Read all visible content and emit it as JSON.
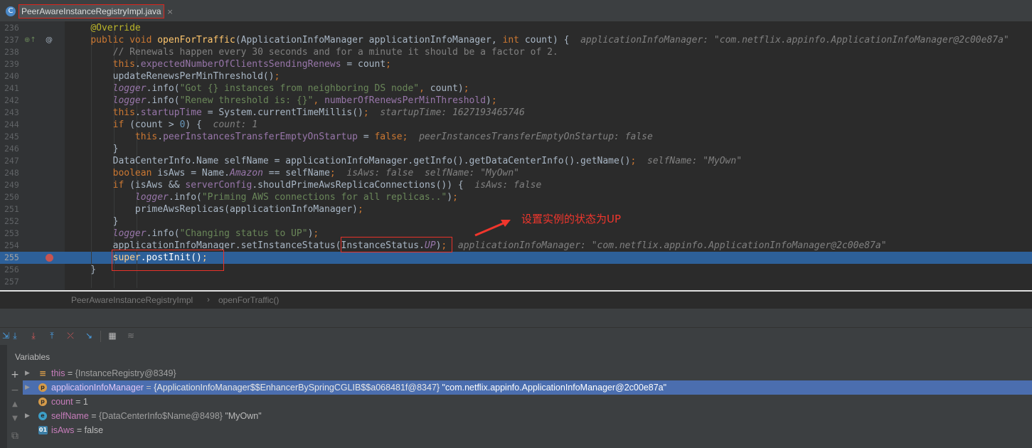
{
  "tab": {
    "title": "PeerAwareInstanceRegistryImpl.java",
    "icon": "C",
    "close": "×"
  },
  "gutter_icons": {
    "override": "⊕↑",
    "annotation": "@"
  },
  "lines": [
    {
      "n": "236",
      "html": "<span class=\"ann\">@Override</span>"
    },
    {
      "n": "237",
      "html": "<span class=\"kw\">public void </span><span class=\"fn\">openForTraffic</span>(ApplicationInfoManager applicationInfoManager, <span class=\"kw\">int </span>count) {  <span class=\"inlay\">applicationInfoManager: \"com.netflix.appinfo.ApplicationInfoManager@2c00e87a\"</span>"
    },
    {
      "n": "238",
      "html": "    <span class=\"cmt\">// Renewals happen every 30 seconds and for a minute it should be a factor of 2.</span>"
    },
    {
      "n": "239",
      "html": "    <span class=\"kw\">this</span>.<span class=\"field\">expectedNumberOfClientsSendingRenews </span>= count<span class=\"kw\">;</span>"
    },
    {
      "n": "240",
      "html": "    updateRenewsPerMinThreshold()<span class=\"kw\">;</span>"
    },
    {
      "n": "241",
      "html": "    <span class=\"logger\">logger</span>.info(<span class=\"str\">\"Got {} instances from neighboring DS node\"</span><span class=\"kw\">, </span>count)<span class=\"kw\">;</span>"
    },
    {
      "n": "242",
      "html": "    <span class=\"logger\">logger</span>.info(<span class=\"str\">\"Renew threshold is: {}\"</span><span class=\"kw\">, </span><span class=\"field\">numberOfRenewsPerMinThreshold</span>)<span class=\"kw\">;</span>"
    },
    {
      "n": "243",
      "html": "    <span class=\"kw\">this</span>.<span class=\"field\">startupTime </span>= System.<span class=\"fn\" style=\"color:#a9b7c6\">currentTimeMillis</span>()<span class=\"kw\">;</span>  <span class=\"inlay\">startupTime: 1627193465746</span>"
    },
    {
      "n": "244",
      "html": "    <span class=\"kw\">if </span>(count &gt; <span class=\"num\">0</span>) {  <span class=\"inlay\">count: 1</span>"
    },
    {
      "n": "245",
      "html": "        <span class=\"kw\">this</span>.<span class=\"field\">peerInstancesTransferEmptyOnStartup </span>= <span class=\"kw\">false;</span>  <span class=\"inlay\">peerInstancesTransferEmptyOnStartup: false</span>"
    },
    {
      "n": "246",
      "html": "    }"
    },
    {
      "n": "247",
      "html": "    DataCenterInfo.Name selfName = applicationInfoManager.getInfo().getDataCenterInfo().getName()<span class=\"kw\">;</span>  <span class=\"inlay\">selfName: \"MyOwn\"</span>"
    },
    {
      "n": "248",
      "html": "    <span class=\"kw\">boolean </span>isAws = Name.<span class=\"static-f\">Amazon </span>== selfName<span class=\"kw\">;</span>  <span class=\"inlay\">isAws: false  selfName: \"MyOwn\"</span>"
    },
    {
      "n": "249",
      "html": "    <span class=\"kw\">if </span>(isAws &amp;&amp; <span class=\"field\">serverConfig</span>.shouldPrimeAwsReplicaConnections()) {  <span class=\"inlay\">isAws: false</span>"
    },
    {
      "n": "250",
      "html": "        <span class=\"logger\">logger</span>.info(<span class=\"str\">\"Priming AWS connections for all replicas..\"</span>)<span class=\"kw\">;</span>"
    },
    {
      "n": "251",
      "html": "        primeAwsReplicas(applicationInfoManager)<span class=\"kw\">;</span>"
    },
    {
      "n": "252",
      "html": "    }"
    },
    {
      "n": "253",
      "html": "    <span class=\"logger\">logger</span>.info(<span class=\"str\">\"Changing status to UP\"</span>)<span class=\"kw\">;</span>"
    },
    {
      "n": "254",
      "html": "    applicationInfoManager.setInstanceStatus(InstanceStatus.<span class=\"static-f\">UP</span>)<span class=\"kw\">;</span>  <span class=\"inlay\">applicationInfoManager: \"com.netflix.appinfo.ApplicationInfoManager@2c00e87a\"</span>"
    },
    {
      "n": "255",
      "html": "    <span class=\"kw\">super</span>.postInit()<span class=\"kw\">;</span>"
    },
    {
      "n": "256",
      "html": "}"
    },
    {
      "n": "257",
      "html": ""
    }
  ],
  "annotation_text": "设置实例的状态为UP",
  "breadcrumb": {
    "class_name": "PeerAwareInstanceRegistryImpl",
    "separator": "›",
    "method": "openForTraffic()"
  },
  "variables": {
    "title": "Variables",
    "rows": [
      {
        "name": "this",
        "eq": " = ",
        "type": "{InstanceRegistry@8349}",
        "value": "",
        "icon": "this-icon",
        "expandable": true,
        "selected": false
      },
      {
        "name": "applicationInfoManager",
        "eq": " = ",
        "type": "{ApplicationInfoManager$$EnhancerBySpringCGLIB$$a068481f@8347}",
        "value": " \"com.netflix.appinfo.ApplicationInfoManager@2c00e87a\"",
        "icon": "p",
        "expandable": true,
        "selected": true
      },
      {
        "name": "count",
        "eq": " = ",
        "type": "",
        "value": "1",
        "icon": "p",
        "expandable": false,
        "selected": false
      },
      {
        "name": "selfName",
        "eq": " = ",
        "type": "{DataCenterInfo$Name@8498}",
        "value": " \"MyOwn\"",
        "icon": "e",
        "expandable": true,
        "selected": false
      },
      {
        "name": "isAws",
        "eq": " = ",
        "type": "",
        "value": "false",
        "icon": "01",
        "expandable": false,
        "selected": false
      }
    ]
  }
}
